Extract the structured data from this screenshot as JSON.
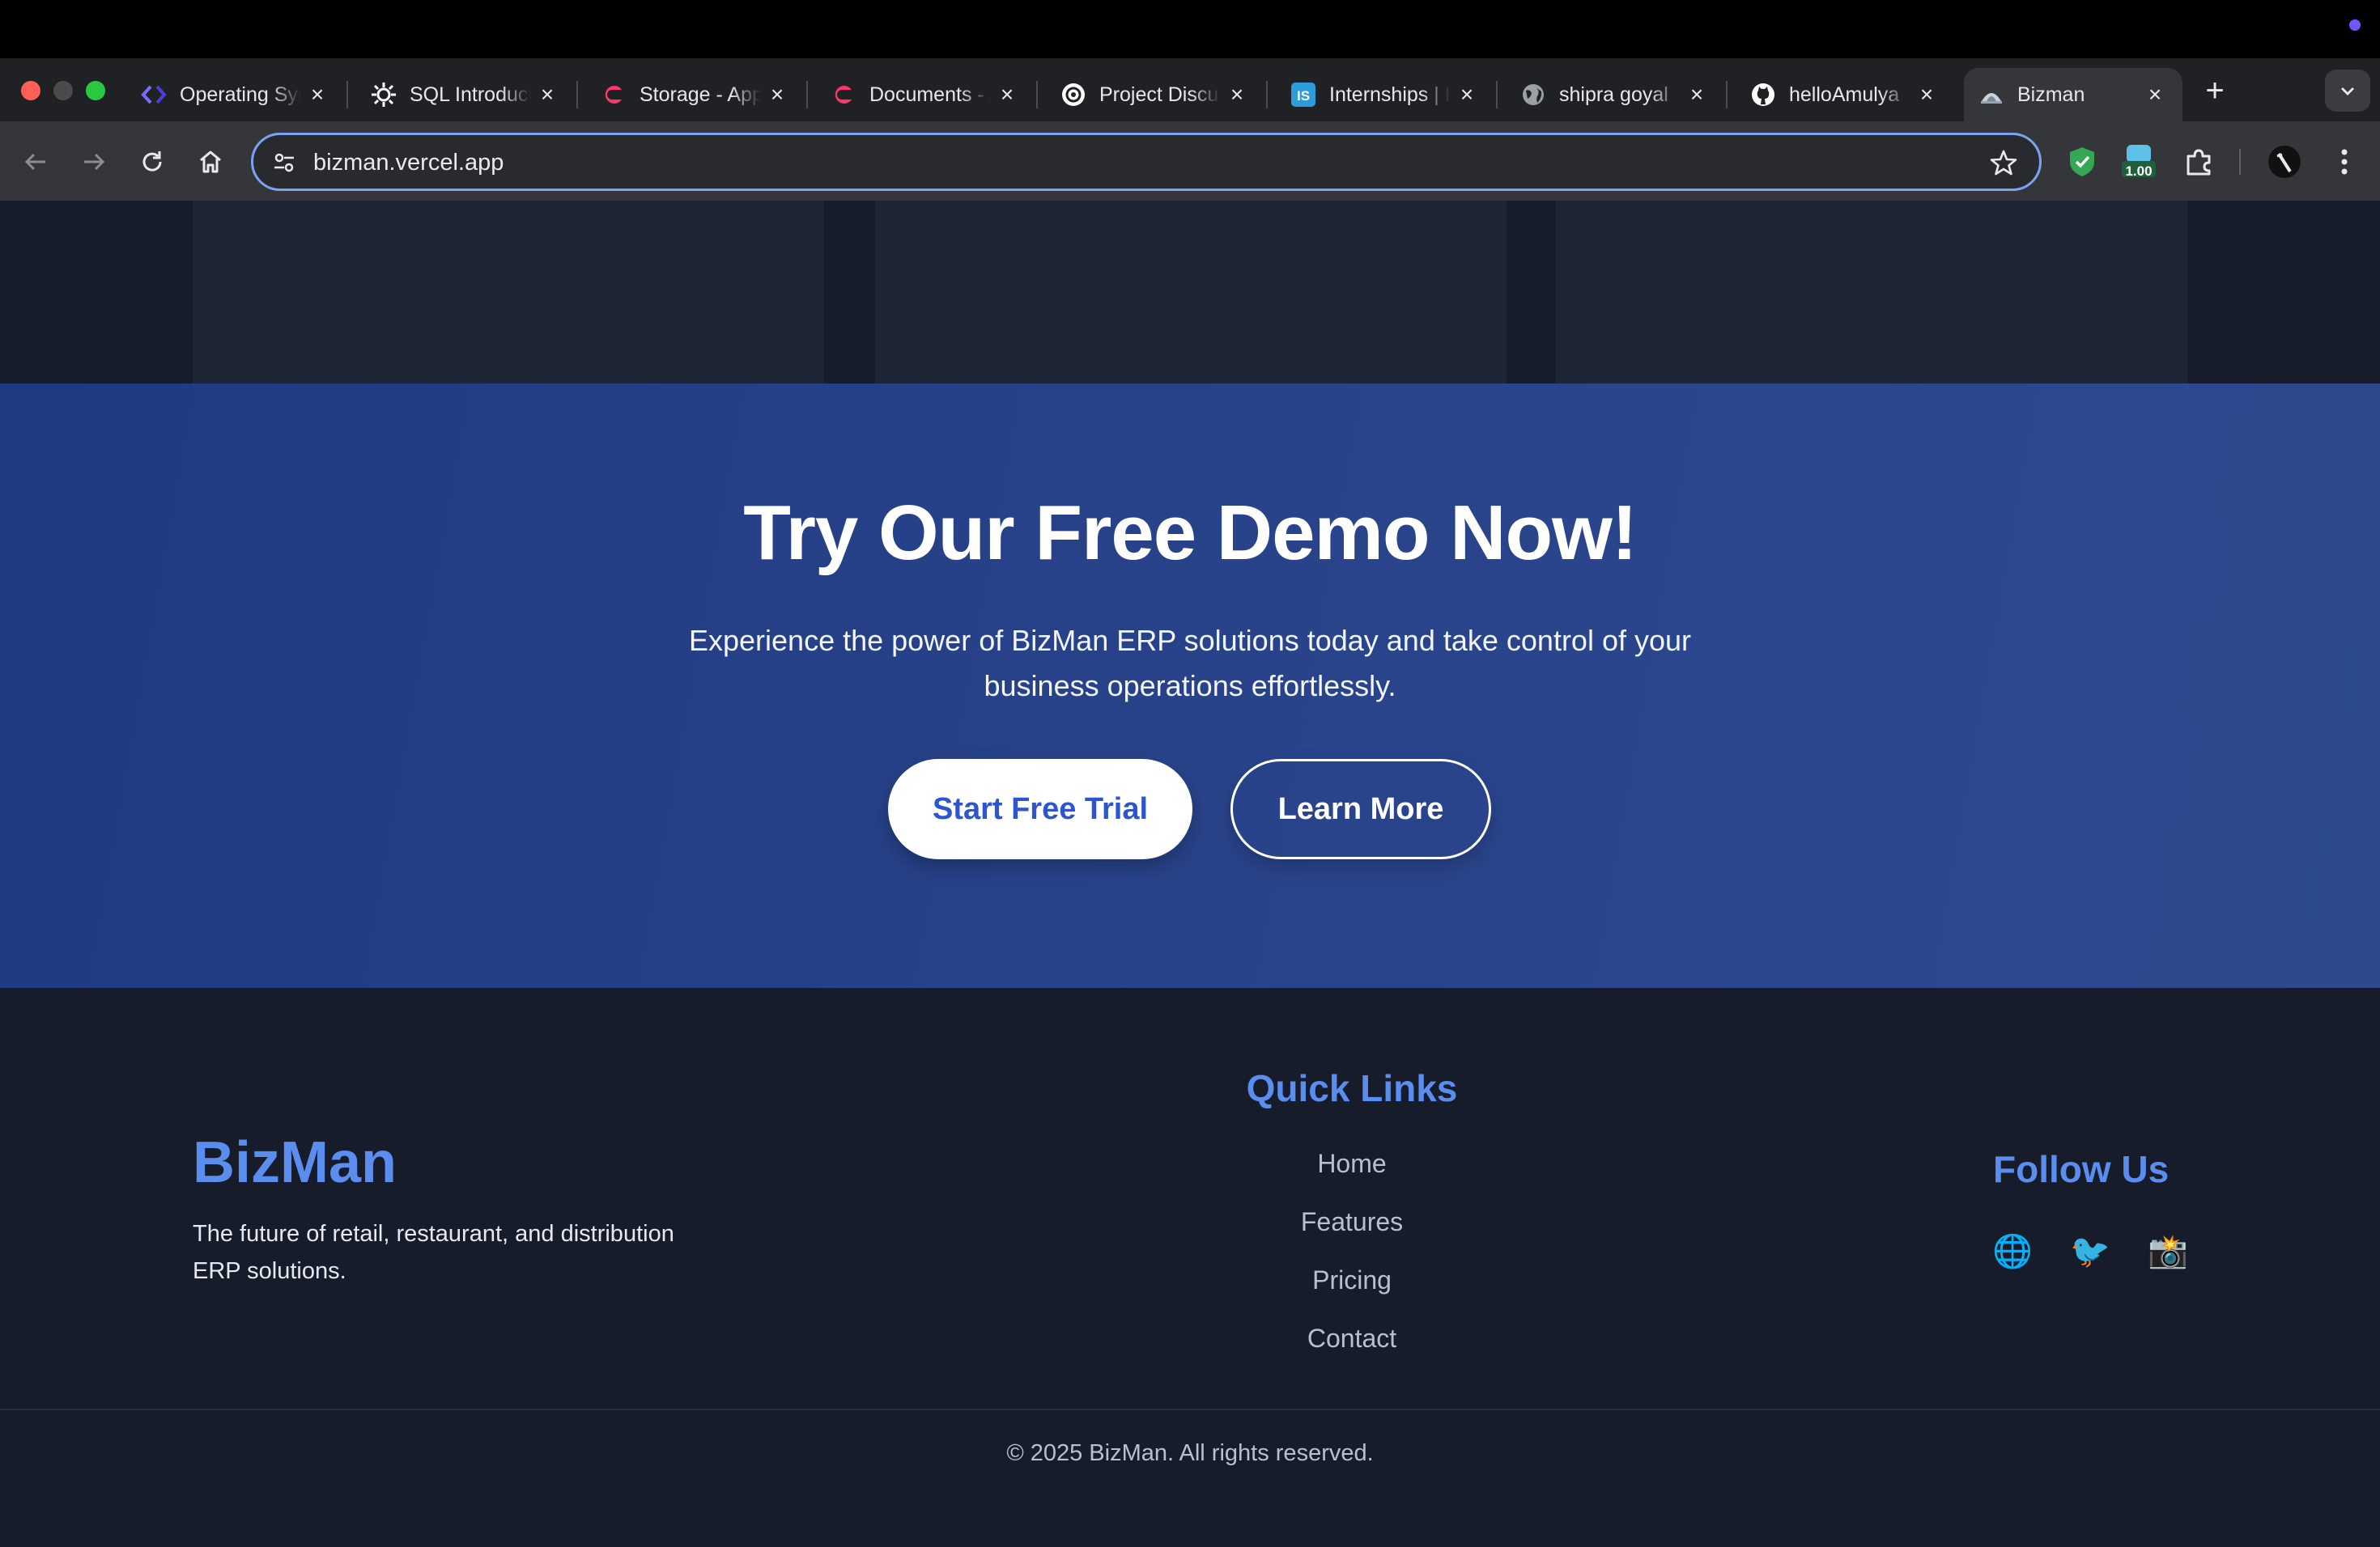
{
  "browser": {
    "tabs": [
      {
        "title": "Operating Systems",
        "favicon": "code-brackets-icon"
      },
      {
        "title": "SQL Introduction",
        "favicon": "gear-burst-icon"
      },
      {
        "title": "Storage - Appwrite",
        "favicon": "appwrite-icon"
      },
      {
        "title": "Documents - Appwrite",
        "favicon": "appwrite-icon"
      },
      {
        "title": "Project Discussion",
        "favicon": "openai-icon"
      },
      {
        "title": "Internships | Internshala",
        "favicon": "internshala-icon"
      },
      {
        "title": "shipra goyal",
        "favicon": "globe-icon"
      },
      {
        "title": "helloAmulya",
        "favicon": "github-icon"
      },
      {
        "title": "Bizman",
        "favicon": "bizman-icon"
      }
    ],
    "active_tab_index": 8,
    "close_glyph": "×",
    "new_tab_glyph": "+",
    "url": "bizman.vercel.app",
    "extension_badge": "1.00"
  },
  "demo": {
    "title": "Try Our Free Demo Now!",
    "subtitle": "Experience the power of BizMan ERP solutions today and take control of your business operations effortlessly.",
    "primary_button": "Start Free Trial",
    "secondary_button": "Learn More"
  },
  "footer": {
    "brand": "BizMan",
    "tagline": "The future of retail, restaurant, and distribution ERP solutions.",
    "quick_links_title": "Quick Links",
    "quick_links": [
      "Home",
      "Features",
      "Pricing",
      "Contact"
    ],
    "follow_title": "Follow Us",
    "social_icons": [
      "🌐",
      "🐦",
      "📸"
    ],
    "copyright": "© 2025 BizMan. All rights reserved."
  },
  "colors": {
    "accent": "#5b8def",
    "demo_bg": "#28428a",
    "page_bg": "#171c2b",
    "primary_text": "#2c55cf"
  }
}
